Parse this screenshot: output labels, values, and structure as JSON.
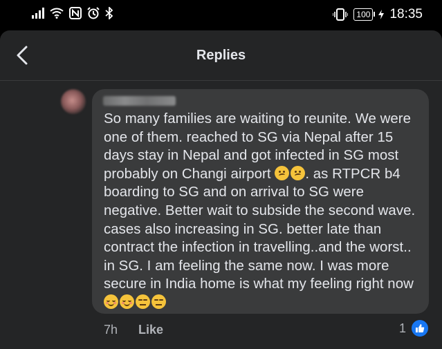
{
  "status_bar": {
    "time": "18:35",
    "battery": "100",
    "icons": [
      "signal-icon",
      "wifi-icon",
      "nfc-icon",
      "alarm-icon",
      "bluetooth-icon",
      "vibrate-icon",
      "charging-icon"
    ]
  },
  "header": {
    "title": "Replies",
    "back_icon": "chevron-left-icon"
  },
  "comment": {
    "author": "",
    "text": "So many families are waiting to reunite. We were one of them. reached to SG via Nepal after 15 days stay in Nepal and got infected in SG most probably on Changi airport",
    "text_mid": ". as RTPCR b4 boarding to SG and on arrival to SG were negative. Better wait to subside the second wave. cases also increasing in SG. better late than contract the infection in travelling..and the worst.. in SG. I am feeling the same now. I was more secure in India home is what my feeling right now",
    "emojis_1": [
      "confused-face",
      "confused-face"
    ],
    "emojis_2": [
      "relieved-face",
      "relieved-face",
      "expressionless-face",
      "expressionless-face"
    ],
    "time_ago": "7h",
    "like_label": "Like",
    "reaction_count": "1",
    "reaction_icon": "thumbs-up-icon",
    "colors": {
      "background": "#242526",
      "bubble": "#3a3b3c",
      "text": "#e4e6eb",
      "secondary": "#b0b3b8",
      "like_blue": "#1877f2"
    }
  }
}
